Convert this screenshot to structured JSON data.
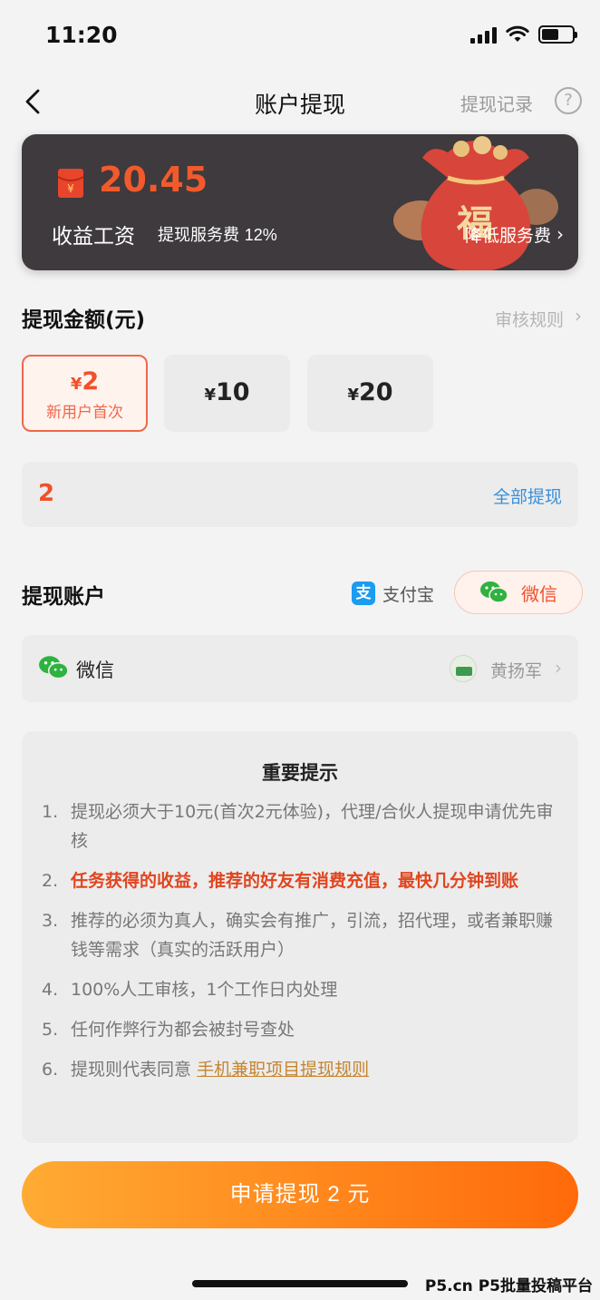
{
  "status_bar": {
    "time": "11:20"
  },
  "nav": {
    "title": "账户提现",
    "record_label": "提现记录",
    "help_label": "?"
  },
  "earnings": {
    "amount": "20.45",
    "label": "收益工资",
    "fee_label": "提现服务费",
    "fee_value": "12%",
    "reduce_fee_label": "降低服务费",
    "bag_char": "福",
    "colors": {
      "accent": "#f25a2c",
      "card_bg": "#3e3a3d"
    }
  },
  "amount_section": {
    "title": "提现金额(元)",
    "rule_link": "审核规则",
    "options": [
      {
        "currency": "¥",
        "value": "2",
        "sub": "新用户首次",
        "selected": true
      },
      {
        "currency": "¥",
        "value": "10",
        "sub": "",
        "selected": false
      },
      {
        "currency": "¥",
        "value": "20",
        "sub": "",
        "selected": false
      }
    ],
    "input_value": "2",
    "withdraw_all": "全部提现"
  },
  "account_section": {
    "title": "提现账户",
    "methods": [
      {
        "icon": "alipay-icon",
        "icon_char": "支",
        "label": "支付宝",
        "selected": false
      },
      {
        "icon": "wechat-icon",
        "label": "微信",
        "selected": true
      }
    ],
    "account": {
      "icon": "wechat-icon",
      "label": "微信",
      "user_name": "黄扬军"
    }
  },
  "notice": {
    "title": "重要提示",
    "items": [
      {
        "num": "1.",
        "text": "提现必须大于10元(首次2元体验)，代理/合伙人提现申请优先审核"
      },
      {
        "num": "2.",
        "text": "任务获得的收益，推荐的好友有消费充值，最快几分钟到账"
      },
      {
        "num": "3.",
        "text": "推荐的必须为真人，确实会有推广，引流，招代理，或者兼职赚钱等需求（真实的活跃用户）"
      },
      {
        "num": "4.",
        "text": "100%人工审核，1个工作日内处理"
      },
      {
        "num": "5.",
        "text": "任何作弊行为都会被封号查处"
      },
      {
        "num": "6.",
        "text": "提现则代表同意",
        "link": "手机兼职项目提现规则"
      }
    ]
  },
  "submit": {
    "label": "申请提现 2 元"
  },
  "watermark": "P5.cn P5批量投稿平台"
}
